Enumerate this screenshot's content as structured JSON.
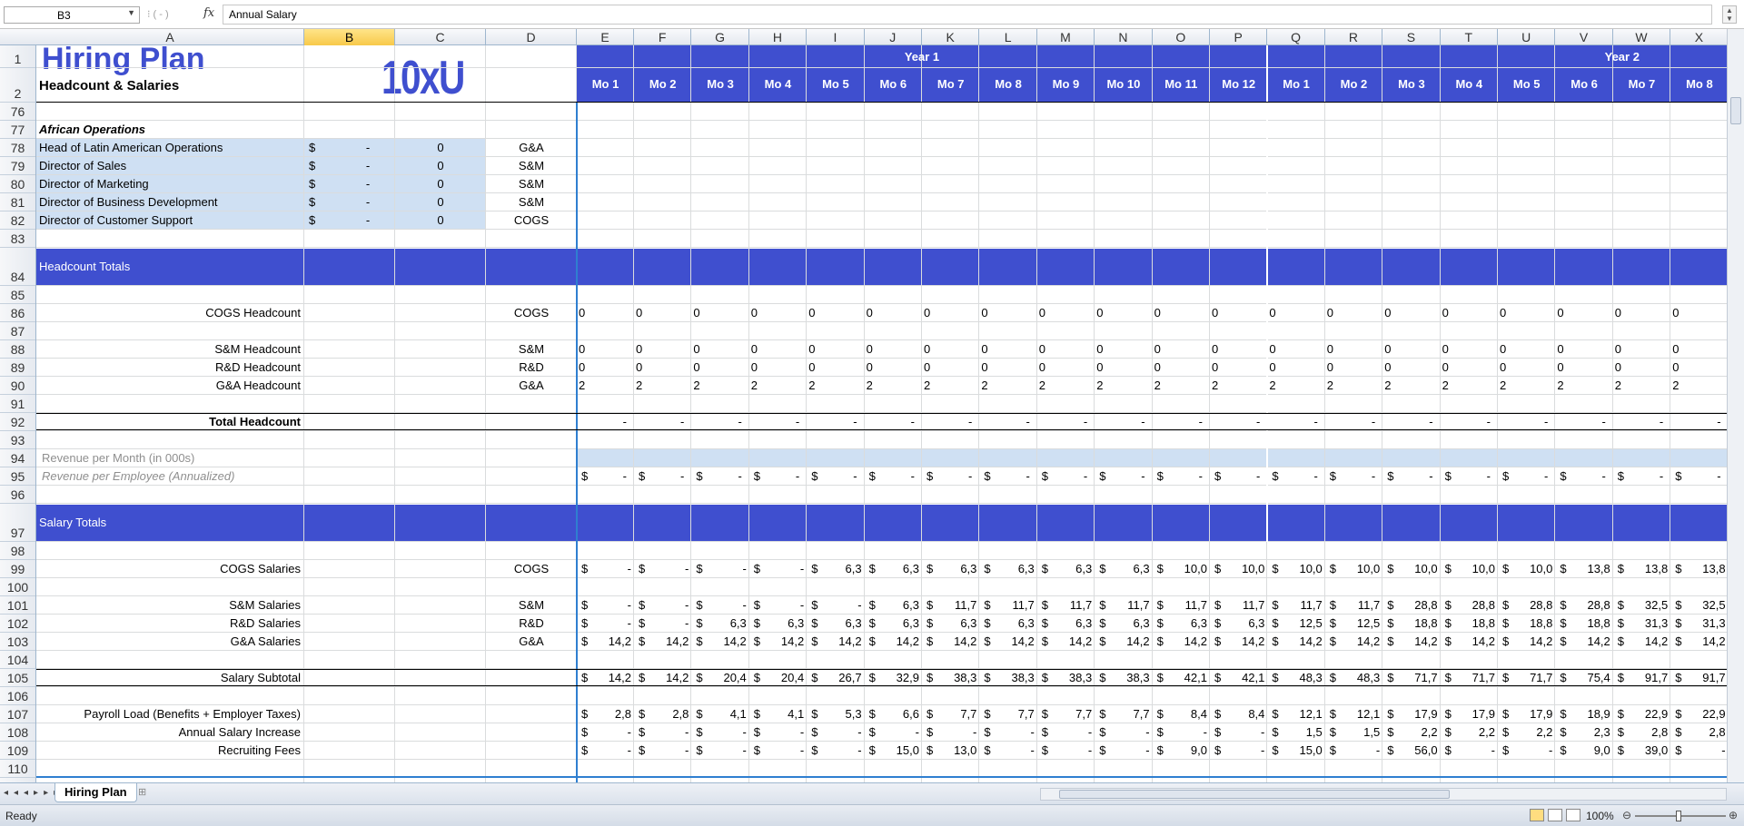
{
  "formula_bar": {
    "cell_ref": "B3",
    "fx": "fx",
    "content": "Annual Salary"
  },
  "columns": [
    "A",
    "B",
    "C",
    "D",
    "E",
    "F",
    "G",
    "H",
    "I",
    "J",
    "K",
    "L",
    "M",
    "N",
    "O",
    "P",
    "Q",
    "R",
    "S",
    "T",
    "U",
    "V",
    "W",
    "X"
  ],
  "selected_column": "B",
  "header": {
    "title": "Hiring Plan",
    "subtitle": "Headcount & Salaries",
    "logo": "10xU",
    "year1": "Year 1",
    "year2": "Year 2",
    "months": [
      "Mo 1",
      "Mo 2",
      "Mo 3",
      "Mo 4",
      "Mo 5",
      "Mo 6",
      "Mo 7",
      "Mo 8",
      "Mo 9",
      "Mo 10",
      "Mo 11",
      "Mo 12",
      "Mo 1",
      "Mo 2",
      "Mo 3",
      "Mo 4",
      "Mo 5",
      "Mo 6",
      "Mo 7",
      "Mo 8"
    ]
  },
  "row_numbers": [
    "1",
    "2",
    "76",
    "77",
    "78",
    "79",
    "80",
    "81",
    "82",
    "83",
    "84",
    "85",
    "86",
    "87",
    "88",
    "89",
    "90",
    "91",
    "92",
    "93",
    "94",
    "95",
    "96",
    "97",
    "98",
    "99",
    "100",
    "101",
    "102",
    "103",
    "104",
    "105",
    "106",
    "107",
    "108",
    "109",
    "110"
  ],
  "african_ops": {
    "title": "African Operations",
    "rows": [
      {
        "label": "Head of Latin American Operations",
        "cur": "$",
        "amt": "-",
        "count": "0",
        "dept": "G&A"
      },
      {
        "label": "Director of Sales",
        "cur": "$",
        "amt": "-",
        "count": "0",
        "dept": "S&M"
      },
      {
        "label": "Director of Marketing",
        "cur": "$",
        "amt": "-",
        "count": "0",
        "dept": "S&M"
      },
      {
        "label": "Director of Business Development",
        "cur": "$",
        "amt": "-",
        "count": "0",
        "dept": "S&M"
      },
      {
        "label": "Director of Customer Support",
        "cur": "$",
        "amt": "-",
        "count": "0",
        "dept": "COGS"
      }
    ]
  },
  "headcount_totals_label": "Headcount Totals",
  "salary_totals_label": "Salary Totals",
  "headcount": [
    {
      "label": "COGS Headcount",
      "dept": "COGS",
      "values": [
        "0",
        "0",
        "0",
        "0",
        "0",
        "0",
        "0",
        "0",
        "0",
        "0",
        "0",
        "0",
        "0",
        "0",
        "0",
        "0",
        "0",
        "0",
        "0",
        "0"
      ]
    },
    {
      "label": "S&M Headcount",
      "dept": "S&M",
      "values": [
        "0",
        "0",
        "0",
        "0",
        "0",
        "0",
        "0",
        "0",
        "0",
        "0",
        "0",
        "0",
        "0",
        "0",
        "0",
        "0",
        "0",
        "0",
        "0",
        "0"
      ]
    },
    {
      "label": "R&D Headcount",
      "dept": "R&D",
      "values": [
        "0",
        "0",
        "0",
        "0",
        "0",
        "0",
        "0",
        "0",
        "0",
        "0",
        "0",
        "0",
        "0",
        "0",
        "0",
        "0",
        "0",
        "0",
        "0",
        "0"
      ]
    },
    {
      "label": "G&A Headcount",
      "dept": "G&A",
      "values": [
        "2",
        "2",
        "2",
        "2",
        "2",
        "2",
        "2",
        "2",
        "2",
        "2",
        "2",
        "2",
        "2",
        "2",
        "2",
        "2",
        "2",
        "2",
        "2",
        "2"
      ]
    }
  ],
  "total_headcount": {
    "label": "Total Headcount",
    "values": [
      "-",
      "-",
      "-",
      "-",
      "-",
      "-",
      "-",
      "-",
      "-",
      "-",
      "-",
      "-",
      "-",
      "-",
      "-",
      "-",
      "-",
      "-",
      "-",
      "-"
    ]
  },
  "revenue_per_month": "Revenue per Month (in 000s)",
  "revenue_per_employee": {
    "label": "Revenue per Employee (Annualized)",
    "values": [
      "-",
      "-",
      "-",
      "-",
      "-",
      "-",
      "-",
      "-",
      "-",
      "-",
      "-",
      "-",
      "-",
      "-",
      "-",
      "-",
      "-",
      "-",
      "-",
      "-"
    ]
  },
  "salaries": [
    {
      "label": "COGS Salaries",
      "dept": "COGS",
      "values": [
        "-",
        "-",
        "-",
        "-",
        "6,3",
        "6,3",
        "6,3",
        "6,3",
        "6,3",
        "6,3",
        "10,0",
        "10,0",
        "10,0",
        "10,0",
        "10,0",
        "10,0",
        "10,0",
        "13,8",
        "13,8",
        "13,8"
      ]
    },
    {
      "label": "S&M Salaries",
      "dept": "S&M",
      "values": [
        "-",
        "-",
        "-",
        "-",
        "-",
        "6,3",
        "11,7",
        "11,7",
        "11,7",
        "11,7",
        "11,7",
        "11,7",
        "11,7",
        "11,7",
        "28,8",
        "28,8",
        "28,8",
        "28,8",
        "32,5",
        "32,5"
      ]
    },
    {
      "label": "R&D Salaries",
      "dept": "R&D",
      "values": [
        "-",
        "-",
        "6,3",
        "6,3",
        "6,3",
        "6,3",
        "6,3",
        "6,3",
        "6,3",
        "6,3",
        "6,3",
        "6,3",
        "12,5",
        "12,5",
        "18,8",
        "18,8",
        "18,8",
        "18,8",
        "31,3",
        "31,3"
      ]
    },
    {
      "label": "G&A Salaries",
      "dept": "G&A",
      "values": [
        "14,2",
        "14,2",
        "14,2",
        "14,2",
        "14,2",
        "14,2",
        "14,2",
        "14,2",
        "14,2",
        "14,2",
        "14,2",
        "14,2",
        "14,2",
        "14,2",
        "14,2",
        "14,2",
        "14,2",
        "14,2",
        "14,2",
        "14,2"
      ]
    }
  ],
  "salary_subtotal": {
    "label": "Salary Subtotal",
    "values": [
      "14,2",
      "14,2",
      "20,4",
      "20,4",
      "26,7",
      "32,9",
      "38,3",
      "38,3",
      "38,3",
      "38,3",
      "42,1",
      "42,1",
      "48,3",
      "48,3",
      "71,7",
      "71,7",
      "71,7",
      "75,4",
      "91,7",
      "91,7"
    ]
  },
  "other": [
    {
      "label": "Payroll Load (Benefits + Employer Taxes)",
      "values": [
        "2,8",
        "2,8",
        "4,1",
        "4,1",
        "5,3",
        "6,6",
        "7,7",
        "7,7",
        "7,7",
        "7,7",
        "8,4",
        "8,4",
        "12,1",
        "12,1",
        "17,9",
        "17,9",
        "17,9",
        "18,9",
        "22,9",
        "22,9"
      ]
    },
    {
      "label": "Annual Salary Increase",
      "values": [
        "-",
        "-",
        "-",
        "-",
        "-",
        "-",
        "-",
        "-",
        "-",
        "-",
        "-",
        "-",
        "1,5",
        "1,5",
        "2,2",
        "2,2",
        "2,2",
        "2,3",
        "2,8",
        "2,8"
      ]
    },
    {
      "label": "Recruiting Fees",
      "values": [
        "-",
        "-",
        "-",
        "-",
        "-",
        "15,0",
        "13,0",
        "-",
        "-",
        "-",
        "9,0",
        "-",
        "15,0",
        "-",
        "56,0",
        "-",
        "-",
        "9,0",
        "39,0",
        "-"
      ]
    }
  ],
  "sheet_tab": "Hiring Plan",
  "status": {
    "ready": "Ready",
    "zoom": "100%"
  },
  "colors": {
    "accent": "#3f4fcf",
    "light_band": "#cfe0f3",
    "title": "#3f4fcf"
  }
}
